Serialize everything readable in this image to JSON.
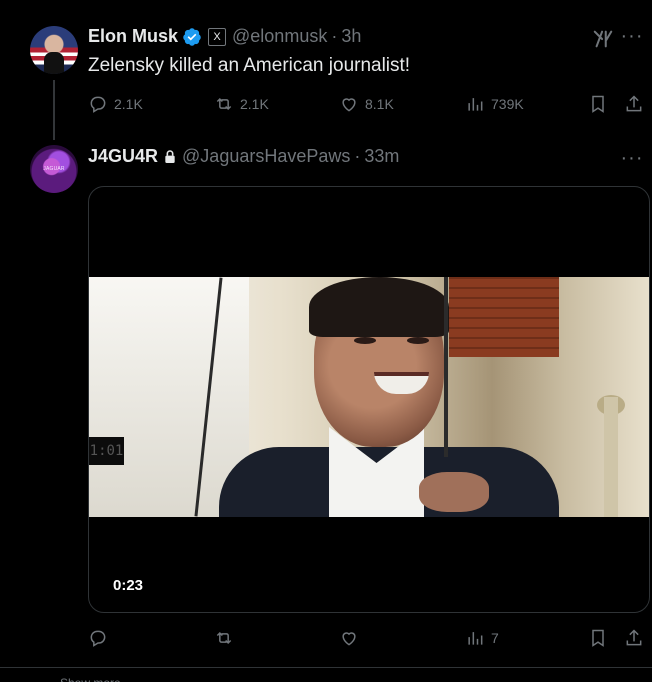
{
  "tweets": [
    {
      "author_name": "Elon Musk",
      "handle": "@elonmusk",
      "separator": "·",
      "time": "3h",
      "text": "Zelensky killed an American journalist!",
      "actions": {
        "replies": "2.1K",
        "reposts": "2.1K",
        "likes": "8.1K",
        "views": "739K"
      },
      "badge_label": "X"
    },
    {
      "author_name": "J4GU4R",
      "handle": "@JaguarsHavePaws",
      "separator": "·",
      "time": "33m",
      "avatar_text": "JAGUAR",
      "video": {
        "duration": "0:23",
        "clock_text": "1:01"
      },
      "actions": {
        "replies": "",
        "reposts": "",
        "likes": "",
        "views": "7"
      }
    }
  ],
  "colors": {
    "background": "#000000",
    "text": "#e7e9ea",
    "muted": "#71767b",
    "verified": "#1d9bf0",
    "border": "#2f3336"
  },
  "icons": [
    "verified-badge-icon",
    "x-affiliate-badge-icon",
    "lock-icon",
    "grok-icon",
    "more-icon",
    "reply-icon",
    "repost-icon",
    "like-icon",
    "views-icon",
    "bookmark-icon",
    "share-icon"
  ],
  "cutoff_text": "Show more"
}
